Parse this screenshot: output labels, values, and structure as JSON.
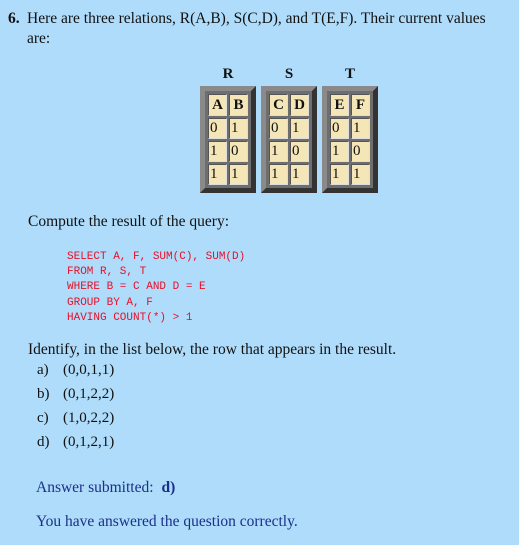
{
  "question": {
    "number": "6.",
    "text": "Here are three relations, R(A,B), S(C,D), and T(E,F). Their current values are:"
  },
  "relations": [
    {
      "name": "R",
      "columns": [
        "A",
        "B"
      ],
      "rows": [
        [
          "0",
          "1"
        ],
        [
          "1",
          "0"
        ],
        [
          "1",
          "1"
        ]
      ]
    },
    {
      "name": "S",
      "columns": [
        "C",
        "D"
      ],
      "rows": [
        [
          "0",
          "1"
        ],
        [
          "1",
          "0"
        ],
        [
          "1",
          "1"
        ]
      ]
    },
    {
      "name": "T",
      "columns": [
        "E",
        "F"
      ],
      "rows": [
        [
          "0",
          "1"
        ],
        [
          "1",
          "0"
        ],
        [
          "1",
          "1"
        ]
      ]
    }
  ],
  "compute_text": "Compute the result of the query:",
  "sql": "SELECT A, F, SUM(C), SUM(D)\nFROM R, S, T\nWHERE B = C AND D = E\nGROUP BY A, F\nHAVING COUNT(*) > 1",
  "identify_text": "Identify, in the list below, the row that appears in the result.",
  "options": [
    {
      "label": "a)",
      "value": "(0,0,1,1)"
    },
    {
      "label": "b)",
      "value": "(0,1,2,2)"
    },
    {
      "label": "c)",
      "value": "(1,0,2,2)"
    },
    {
      "label": "d)",
      "value": "(0,1,2,1)"
    }
  ],
  "answer": {
    "label": "Answer submitted:",
    "value": "d)"
  },
  "feedback": "You have answered the question correctly.",
  "colors": {
    "background": "#aedcfa",
    "sql": "#e8102a",
    "feedback": "#1a2f8a",
    "cell": "#f5e6b8"
  }
}
